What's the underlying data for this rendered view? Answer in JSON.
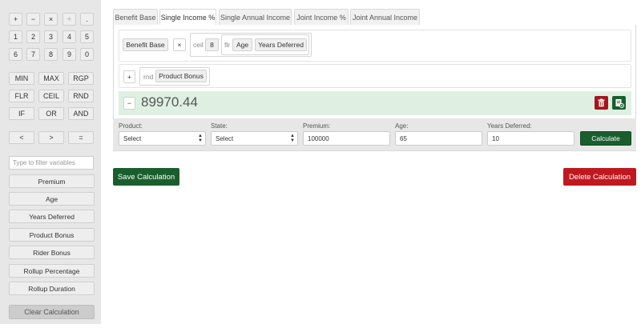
{
  "keypad": {
    "row1": [
      "+",
      "−",
      "×",
      "÷",
      "."
    ],
    "row2": [
      "1",
      "2",
      "3",
      "4",
      "5"
    ],
    "row3": [
      "6",
      "7",
      "8",
      "9",
      "0"
    ],
    "fn1": [
      "MIN",
      "MAX",
      "RGP"
    ],
    "fn2": [
      "FLR",
      "CEIL",
      "RND"
    ],
    "fn3": [
      "IF",
      "OR",
      "AND"
    ],
    "cmp": [
      "<",
      ">",
      "="
    ]
  },
  "filter": {
    "placeholder": "Type to filter variables"
  },
  "variables": [
    "Premium",
    "Age",
    "Years Deferred",
    "Product Bonus",
    "Rider Bonus",
    "Rollup Percentage",
    "Rollup Duration"
  ],
  "clear_label": "Clear Calculation",
  "tabs": [
    "Benefit Base",
    "Single Income %",
    "Single Annual Income",
    "Joint Income %",
    "Joint Annual Income"
  ],
  "active_tab": "Single Income %",
  "expression": {
    "chip_benefit_base": "Benefit Base",
    "op_times": "×",
    "ceil_label": "ceil",
    "ceil_value": "8",
    "flr_label": "flr",
    "age": "Age",
    "years_deferred": "Years Deferred",
    "plus": "+",
    "rnd_label": "rnd",
    "product_bonus": "Product Bonus",
    "minus": "−",
    "result": "89970.44"
  },
  "fields": {
    "product": {
      "label": "Product:",
      "value": "Select"
    },
    "state": {
      "label": "State:",
      "value": "Select"
    },
    "premium": {
      "label": "Premium:",
      "value": "100000"
    },
    "age": {
      "label": "Age:",
      "value": "65"
    },
    "years_deferred": {
      "label": "Years Deferred:",
      "value": "10"
    },
    "calculate_label": "Calculate"
  },
  "actions": {
    "save": "Save Calculation",
    "delete": "Delete Calculation"
  },
  "colors": {
    "green": "#1b5e2e",
    "red": "#c0181f",
    "result_bg": "#dff0e3"
  },
  "icons": {
    "delete": "trash-icon",
    "save": "save-doc-icon",
    "select": "up-down-arrows-icon"
  }
}
